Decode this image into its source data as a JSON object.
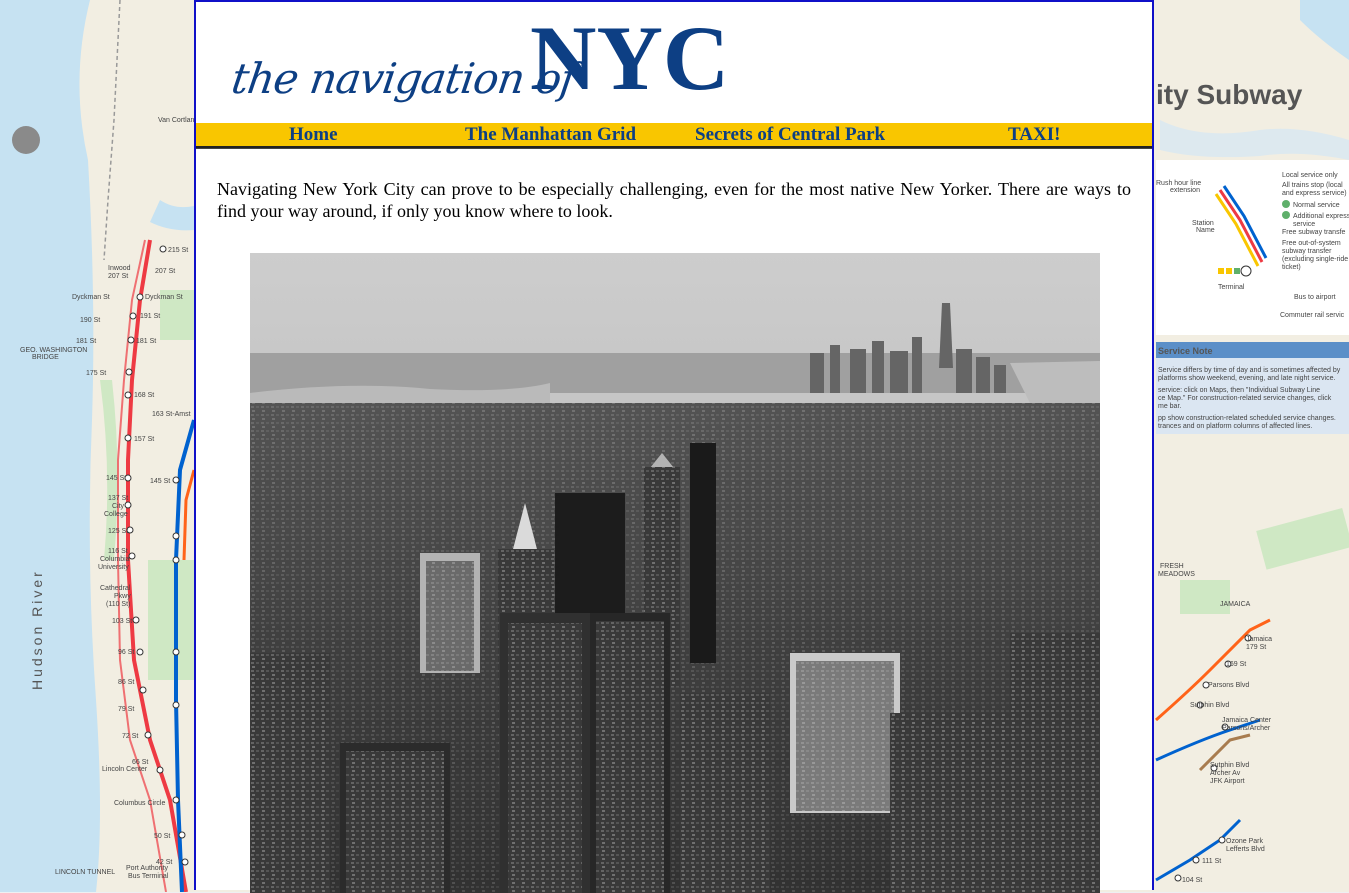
{
  "site": {
    "logo_script": "the navigation of",
    "logo_main": "NYC"
  },
  "nav": {
    "items": [
      {
        "label": "Home"
      },
      {
        "label": "The Manhattan Grid"
      },
      {
        "label": "Secrets of Central Park"
      },
      {
        "label": "TAXI!"
      }
    ]
  },
  "content": {
    "intro": "Navigating New York City can prove to be especially challenging, even for the most native New Yorker. There are ways to find your way around, if only you know where to look."
  },
  "background_map": {
    "title_fragment": "ity Subway",
    "river_label": "Hudson River",
    "stations_left": [
      "Van Cortlandt",
      "Inwood 207 St",
      "215 St",
      "207 St",
      "Dyckman St",
      "Dyckman St",
      "191 St",
      "190 St",
      "181 St",
      "181 St",
      "175 St",
      "168 St",
      "163 St-Amsterdam",
      "157 St",
      "145 St",
      "145 St",
      "137 St City College",
      "125 St",
      "116 St Columbia University",
      "Cathedral Pkwy (110 St)",
      "103 St",
      "96 St",
      "86 St",
      "79 St",
      "72 St",
      "66 St Lincoln Center",
      "59 St Columbus Circle",
      "50 St",
      "42 St Port Authority Bus Terminal"
    ],
    "legend_items": [
      "Local service only",
      "All trains stop (local and express service)",
      "Rush hour line extension",
      "Normal service",
      "Additional express service",
      "Station Name",
      "Free subway transfer",
      "Free out-of-system subway transfer (excluding single-ride ticket)",
      "Terminal",
      "Bus to airport",
      "Commuter rail service"
    ],
    "service_note_title": "Service Note",
    "service_note_text": "Service differs by time of day and is sometimes affected by platforms show weekend, evening, and late night service.",
    "stations_right": [
      "Jamaica 179 St",
      "169 St",
      "Parsons Blvd",
      "Sutphin Blvd",
      "Jamaica Center Parsons/Archer",
      "Sutphin Blvd Archer Av JFK Airport",
      "Ozone Park Lefferts Blvd",
      "111 St",
      "104 St"
    ],
    "colors": {
      "red_line": "#ee3a43",
      "blue_line": "#0062cf",
      "orange_line": "#ff6319",
      "water": "#c6e2f2",
      "park": "#cfe8c4",
      "land": "#f2eee2"
    }
  },
  "colors": {
    "navbar_bg": "#f9c600",
    "brand_blue": "#0d3f84",
    "page_border": "#1010c8"
  }
}
